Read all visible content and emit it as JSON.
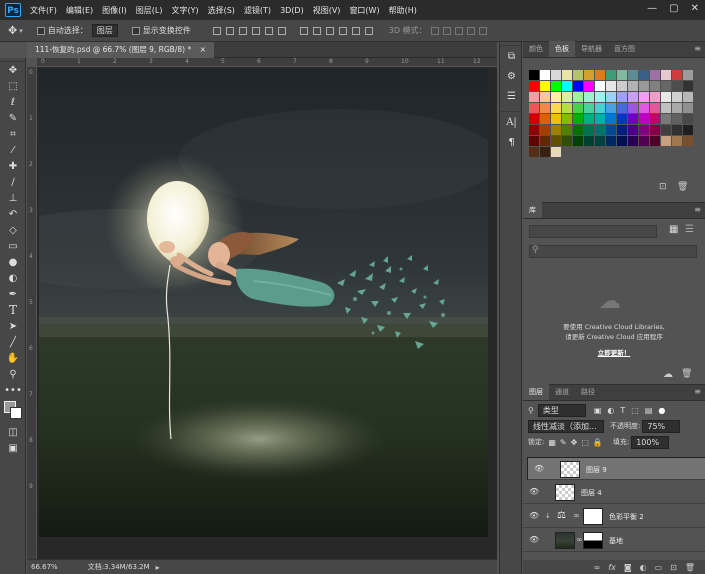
{
  "app": {
    "logo": "Ps"
  },
  "menu": [
    "文件(F)",
    "编辑(E)",
    "图像(I)",
    "图层(L)",
    "文字(Y)",
    "选择(S)",
    "滤镜(T)",
    "3D(D)",
    "视图(V)",
    "窗口(W)",
    "帮助(H)"
  ],
  "window_controls": [
    "—",
    "▢",
    "✕"
  ],
  "options": {
    "auto_select_label": "自动选择：",
    "auto_select_value": "图层",
    "show_transform_label": "显示变换控件",
    "mode_label": "3D 模式："
  },
  "document": {
    "tab_title": "111-恢复的.psd @ 66.7% (图层 9, RGB/8) *",
    "tab_close": "×"
  },
  "ruler_top": [
    "0",
    "1",
    "2",
    "3",
    "4",
    "5",
    "6",
    "7",
    "8",
    "9",
    "10",
    "11",
    "12"
  ],
  "ruler_left": [
    "0",
    "1",
    "2",
    "3",
    "4",
    "5",
    "6",
    "7",
    "8",
    "9"
  ],
  "status": {
    "zoom": "66.67%",
    "doc_info": "文档:3.34M/63.2M"
  },
  "tools": [
    "move-tool-icon",
    "marquee-tool-icon",
    "lasso-tool-icon",
    "quick-select-tool-icon",
    "crop-tool-icon",
    "eyedropper-tool-icon",
    "healing-brush-tool-icon",
    "brush-tool-icon",
    "clone-stamp-tool-icon",
    "history-brush-tool-icon",
    "eraser-tool-icon",
    "gradient-tool-icon",
    "blur-tool-icon",
    "dodge-tool-icon",
    "pen-tool-icon",
    "type-tool-icon",
    "path-select-tool-icon",
    "line-tool-icon",
    "hand-tool-icon",
    "zoom-tool-icon",
    "more-tools-icon"
  ],
  "color_panel": {
    "tabs": [
      "颜色",
      "色板",
      "导航器",
      "直方图"
    ],
    "active_tab": 1,
    "swatches": [
      "#000000",
      "#ffffff",
      "#d9d9d9",
      "#e8e6a0",
      "#b4c46a",
      "#d4a030",
      "#e07820",
      "#3c9c78",
      "#80b8a0",
      "#5c8c94",
      "#386088",
      "#a070a8",
      "#e8c8d0",
      "#d03c3c",
      "#9c9c9c",
      "#ff0000",
      "#ffff00",
      "#00ff00",
      "#00ffff",
      "#0000ff",
      "#ff00ff",
      "#ffffff",
      "#e6e6e6",
      "#cccccc",
      "#b3b3b3",
      "#999999",
      "#808080",
      "#666666",
      "#4d4d4d",
      "#333333",
      "#f0a0a0",
      "#f8c8a0",
      "#fff0a0",
      "#d8f0a0",
      "#a0f0a0",
      "#a0f0d0",
      "#a0f0f0",
      "#a0d0f0",
      "#a0a0f0",
      "#c8a0f0",
      "#f0a0f0",
      "#f0a0c8",
      "#e8e8e8",
      "#d0d0d0",
      "#b8b8b8",
      "#e85858",
      "#f08848",
      "#f8d850",
      "#b0e048",
      "#48d048",
      "#48d0a0",
      "#48d0d0",
      "#48a0e0",
      "#4868e0",
      "#9858e0",
      "#e058e0",
      "#e05898",
      "#c0c0c0",
      "#a8a8a8",
      "#909090",
      "#d00000",
      "#e06000",
      "#f0c000",
      "#80c000",
      "#00b000",
      "#00b080",
      "#00b0b0",
      "#0078d0",
      "#0038c0",
      "#7000c0",
      "#c000c0",
      "#c00070",
      "#787878",
      "#606060",
      "#484848",
      "#900000",
      "#a04000",
      "#a08000",
      "#508000",
      "#007000",
      "#007050",
      "#007070",
      "#004890",
      "#002080",
      "#480080",
      "#800080",
      "#800048",
      "#404040",
      "#303030",
      "#202020",
      "#600000",
      "#602800",
      "#605000",
      "#305000",
      "#004000",
      "#004030",
      "#004040",
      "#002860",
      "#001050",
      "#280050",
      "#500050",
      "#500028",
      "#c8a080",
      "#a07850",
      "#785030",
      "#503018",
      "#382010",
      "#e8d8c0"
    ]
  },
  "library_panel": {
    "tab": "库",
    "message_line1": "要使用 Creative Cloud Libraries,",
    "message_line2": "请更新 Creative Cloud 应用程序",
    "link": "立即更新！"
  },
  "layers_panel": {
    "tabs": [
      "图层",
      "通道",
      "路径"
    ],
    "active_tab": 0,
    "filter_label": "类型",
    "blend_mode": "线性减淡（添加...",
    "opacity_label": "不透明度:",
    "opacity_value": "75%",
    "lock_label": "锁定:",
    "fill_label": "填充:",
    "fill_value": "100%",
    "layers": [
      {
        "name": "图层 9",
        "selected": true,
        "thumb": "transparent"
      },
      {
        "name": "图层 4",
        "selected": false,
        "thumb": "transparent"
      },
      {
        "name": "色彩平衡 2",
        "selected": false,
        "thumb": "adjustment"
      },
      {
        "name": "基地",
        "selected": false,
        "thumb": "image"
      }
    ]
  }
}
